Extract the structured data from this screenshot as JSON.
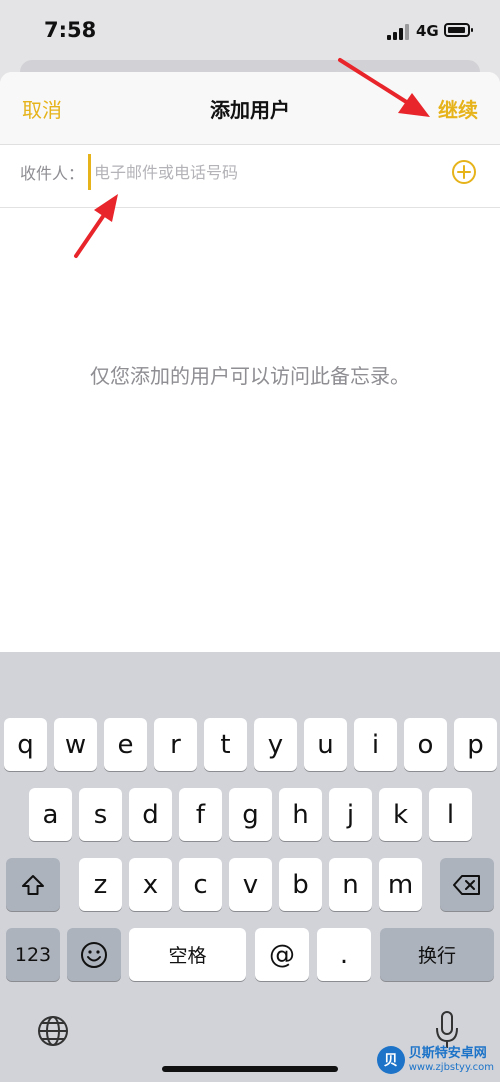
{
  "status_bar": {
    "time": "7:58",
    "network": "4G"
  },
  "nav": {
    "cancel": "取消",
    "title": "添加用户",
    "continue": "继续"
  },
  "recipient": {
    "label": "收件人：",
    "placeholder": "电子邮件或电话号码",
    "value": ""
  },
  "hint": "仅您添加的用户可以访问此备忘录。",
  "colors": {
    "accent": "#e6b31a",
    "annotation_arrow": "#e8252a",
    "keyboard_bg": "#d1d3d9"
  },
  "keyboard": {
    "row1": [
      "q",
      "w",
      "e",
      "r",
      "t",
      "y",
      "u",
      "i",
      "o",
      "p"
    ],
    "row2": [
      "a",
      "s",
      "d",
      "f",
      "g",
      "h",
      "j",
      "k",
      "l"
    ],
    "row3": [
      "z",
      "x",
      "c",
      "v",
      "b",
      "n",
      "m"
    ],
    "numbers_key": "123",
    "space_key": "空格",
    "at_key": "@",
    "dot_key": ".",
    "return_key": "换行",
    "icons": [
      "shift-icon",
      "delete-icon",
      "emoji-icon",
      "globe-icon",
      "microphone-icon"
    ]
  },
  "watermark": {
    "logo": "贝",
    "title": "贝斯特安卓网",
    "url": "www.zjbstyy.com"
  }
}
